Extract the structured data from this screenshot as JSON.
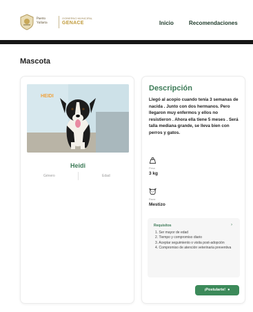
{
  "header": {
    "logo_line1": "Puerto\nVallarta",
    "logo_line2": "GOBIERNO MUNICIPAL",
    "logo_line3": "GENACE",
    "nav": [
      {
        "label": "Inicio"
      },
      {
        "label": "Recomendaciones"
      }
    ]
  },
  "page": {
    "title": "Mascota"
  },
  "pet": {
    "photo_watermark": "HEIDI",
    "name": "Heidi",
    "sexo_label": "Género",
    "edad_label": "Edad"
  },
  "details": {
    "title": "Descripción",
    "description": "Llegó al acopio cuando tenía 3 semanas de nacida . Junto con dos hermanos. Pero llegaron muy enfermos y ellos no resistieron . Ahora ella tiene 5 meses . Será talla mediana grande, se lleva bien con perros y gatos.",
    "peso_label": "Peso",
    "peso_value": "3 kg",
    "raza_label": "Raza",
    "raza_value": "Mestizo"
  },
  "requirements": {
    "title": "Requisitos",
    "items": [
      "1. Ser mayor de edad",
      "2. Tiempo y compromiso diario",
      "3. Aceptar seguimiento o visita post-adopción",
      "4. Compromiso de atención veterinaria preventiva"
    ]
  },
  "actions": {
    "apply_label": "¡Postularte!"
  },
  "colors": {
    "accent": "#3c8a5a",
    "title_green": "#3c7a57",
    "header_bar": "#161616"
  }
}
